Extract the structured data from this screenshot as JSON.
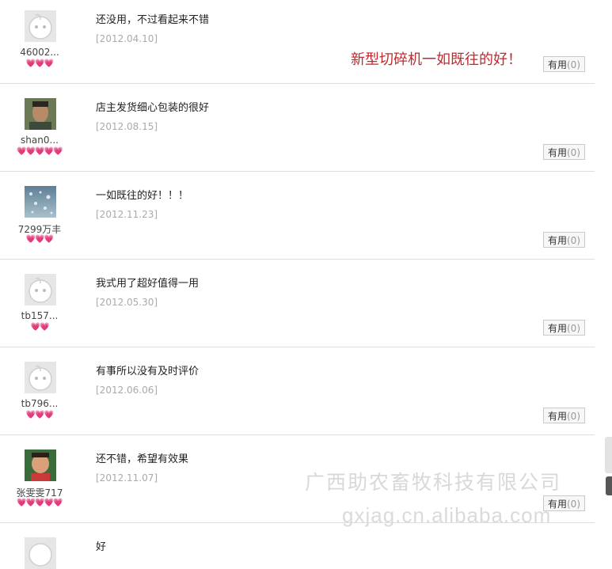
{
  "reviews": [
    {
      "user": "46002...",
      "hearts": "💗💗💗",
      "text": "还没用，不过看起来不错",
      "date": "[2012.04.10]",
      "useful_label": "有用",
      "useful_count": "(0)",
      "avatar": "default"
    },
    {
      "user": "shan0...",
      "hearts": "💗💗💗💗💗",
      "text": "店主发货细心包装的很好",
      "date": "[2012.08.15]",
      "useful_label": "有用",
      "useful_count": "(0)",
      "avatar": "photo-man"
    },
    {
      "user": "7299万丰",
      "hearts": "💗💗💗",
      "text": "一如既往的好！！！",
      "date": "[2012.11.23]",
      "useful_label": "有用",
      "useful_count": "(0)",
      "avatar": "photo-drops"
    },
    {
      "user": "tb157...",
      "hearts": "💗💗",
      "text": "我式用了超好值得一用",
      "date": "[2012.05.30]",
      "useful_label": "有用",
      "useful_count": "(0)",
      "avatar": "default"
    },
    {
      "user": "tb796...",
      "hearts": "💗💗💗",
      "text": "有事所以没有及时评价",
      "date": "[2012.06.06]",
      "useful_label": "有用",
      "useful_count": "(0)",
      "avatar": "default"
    },
    {
      "user": "张雯雯717",
      "hearts": "💗💗💗💗💗",
      "text": "还不错，希望有效果",
      "date": "[2012.11.07]",
      "useful_label": "有用",
      "useful_count": "(0)",
      "avatar": "photo-child"
    },
    {
      "user": "",
      "hearts": "",
      "text": "好",
      "date": "",
      "useful_label": "",
      "useful_count": "",
      "avatar": "default"
    }
  ],
  "overlay_text": "新型切碎机一如既往的好！",
  "watermark_company": "广西助农畜牧科技有限公司",
  "watermark_url": "gxjag.cn.alibaba.com"
}
